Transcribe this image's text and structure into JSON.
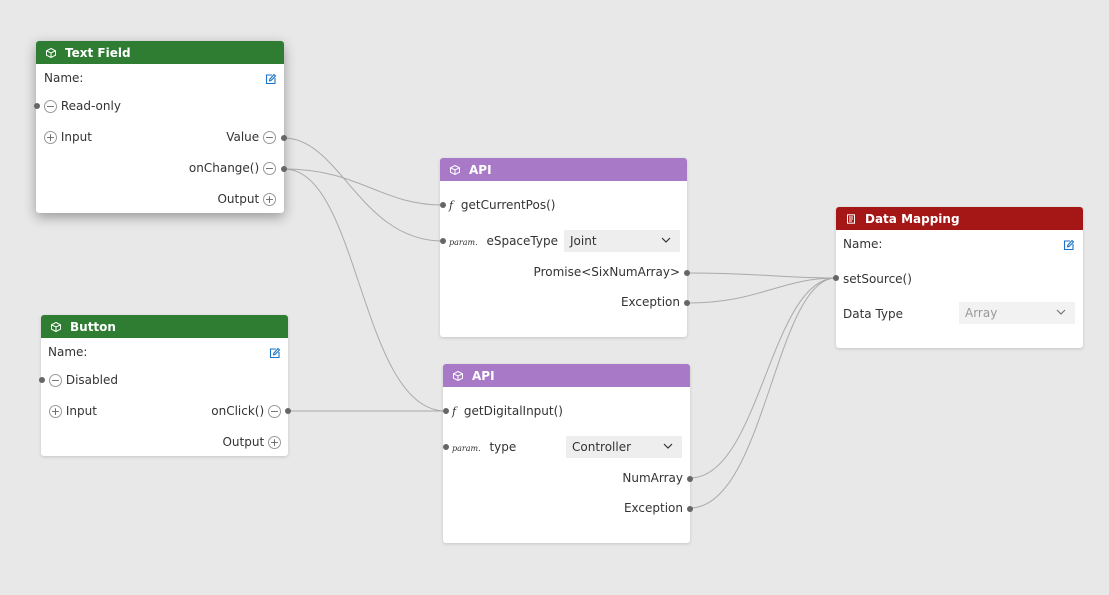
{
  "text_field": {
    "title": "Text Field",
    "name_label": "Name:",
    "readonly_label": "Read-only",
    "input_label": "Input",
    "value_label": "Value",
    "onchange_label": "onChange()",
    "output_label": "Output"
  },
  "button": {
    "title": "Button",
    "name_label": "Name:",
    "disabled_label": "Disabled",
    "input_label": "Input",
    "onclick_label": "onClick()",
    "output_label": "Output"
  },
  "api1": {
    "title": "API",
    "fn_label": "getCurrentPos()",
    "param_tag": "param.",
    "param_label": "eSpaceType",
    "param_value": "Joint",
    "out1_label": "Promise<SixNumArray>",
    "out2_label": "Exception"
  },
  "api2": {
    "title": "API",
    "fn_label": "getDigitalInput()",
    "param_tag": "param.",
    "param_label": "type",
    "param_value": "Controller",
    "out1_label": "NumArray",
    "out2_label": "Exception"
  },
  "data_mapping": {
    "title": "Data Mapping",
    "name_label": "Name:",
    "source_label": "setSource()",
    "datatype_label": "Data Type",
    "datatype_value": "Array"
  },
  "symbols": {
    "minus": "−",
    "plus": "+",
    "fx": "f"
  },
  "colors": {
    "component_header": "#2e7d32",
    "api_header": "#a779c6",
    "mapping_header": "#a51616",
    "edit_icon": "#1a73c8",
    "wire": "#aaaaaa",
    "canvas": "#e8e8e8"
  }
}
